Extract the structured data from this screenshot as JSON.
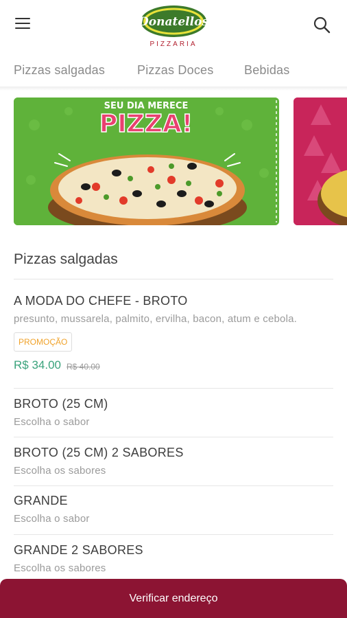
{
  "header": {
    "logo_name": "Donatellos",
    "logo_tagline": "PIZZARIA",
    "colors": {
      "logo_green": "#3c7a2a",
      "logo_yellow": "#e8e23a",
      "logo_red": "#b11f2e"
    }
  },
  "tabs": [
    {
      "label": "Pizzas salgadas"
    },
    {
      "label": "Pizzas Doces"
    },
    {
      "label": "Bebidas"
    }
  ],
  "banners": [
    {
      "line1": "SEU DIA MERECE",
      "line2": "PIZZA!",
      "colors": {
        "bg": "#5fb23a",
        "headline": "#e8416f"
      }
    },
    {
      "colors": {
        "bg": "#c8255a"
      }
    }
  ],
  "section": {
    "title": "Pizzas salgadas"
  },
  "items": [
    {
      "title": "A MODA DO CHEFE - BROTO",
      "description": "presunto, mussarela, palmito, ervilha, bacon, atum e cebola.",
      "badge": "PROMOÇÃO",
      "price": "R$ 34.00",
      "old_price": "R$ 40.00"
    },
    {
      "title": "BROTO (25 CM)",
      "description": "Escolha o sabor"
    },
    {
      "title": "BROTO (25 CM) 2 SABORES",
      "description": "Escolha os sabores"
    },
    {
      "title": "GRANDE",
      "description": "Escolha o sabor"
    },
    {
      "title": "GRANDE 2 SABORES",
      "description": "Escolha os sabores"
    }
  ],
  "bottom_bar": {
    "label": "Verificar endereço",
    "color": "#8c1433"
  },
  "colors": {
    "price": "#3aa37c",
    "promo": "#f0a22a"
  }
}
